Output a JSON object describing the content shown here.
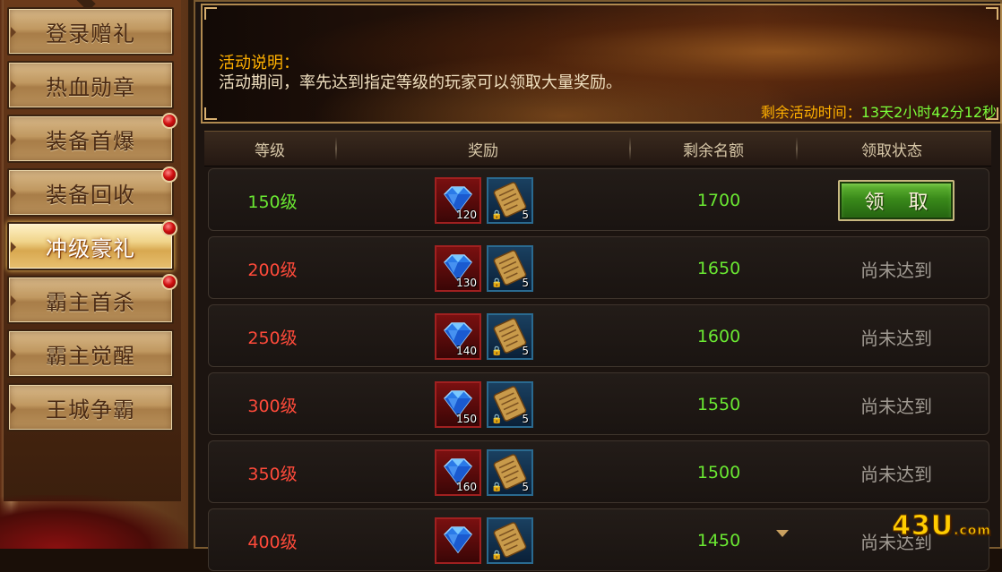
{
  "sidebar": {
    "items": [
      {
        "label": "登录赠礼",
        "badge": false,
        "active": false
      },
      {
        "label": "热血勋章",
        "badge": false,
        "active": false
      },
      {
        "label": "装备首爆",
        "badge": true,
        "active": false
      },
      {
        "label": "装备回收",
        "badge": true,
        "active": false
      },
      {
        "label": "冲级豪礼",
        "badge": true,
        "active": true
      },
      {
        "label": "霸主首杀",
        "badge": true,
        "active": false
      },
      {
        "label": "霸主觉醒",
        "badge": false,
        "active": false
      },
      {
        "label": "王城争霸",
        "badge": false,
        "active": false
      }
    ]
  },
  "banner": {
    "title": "活动说明：",
    "text": "活动期间，率先达到指定等级的玩家可以领取大量奖励。",
    "countdown_label": "剩余活动时间：",
    "countdown_value": "13天2小时42分12秒"
  },
  "table": {
    "headers": [
      "等级",
      "奖励",
      "剩余名额",
      "领取状态"
    ],
    "rows": [
      {
        "level": "150级",
        "level_color": "green",
        "gem_count": "120",
        "scroll_count": "5",
        "remaining": "1700",
        "status": "领 取",
        "claimable": true
      },
      {
        "level": "200级",
        "level_color": "red",
        "gem_count": "130",
        "scroll_count": "5",
        "remaining": "1650",
        "status": "尚未达到",
        "claimable": false
      },
      {
        "level": "250级",
        "level_color": "red",
        "gem_count": "140",
        "scroll_count": "5",
        "remaining": "1600",
        "status": "尚未达到",
        "claimable": false
      },
      {
        "level": "300级",
        "level_color": "red",
        "gem_count": "150",
        "scroll_count": "5",
        "remaining": "1550",
        "status": "尚未达到",
        "claimable": false
      },
      {
        "level": "350级",
        "level_color": "red",
        "gem_count": "160",
        "scroll_count": "5",
        "remaining": "1500",
        "status": "尚未达到",
        "claimable": false
      },
      {
        "level": "400级",
        "level_color": "red",
        "gem_count": "",
        "scroll_count": "",
        "remaining": "1450",
        "status": "尚未达到",
        "claimable": false
      }
    ]
  },
  "watermark": {
    "main": "43U",
    "suffix": ".com"
  },
  "colors": {
    "accent_gold": "#ffb000",
    "green": "#6ae832",
    "red": "#ff4a3a",
    "muted": "#a09a92"
  }
}
